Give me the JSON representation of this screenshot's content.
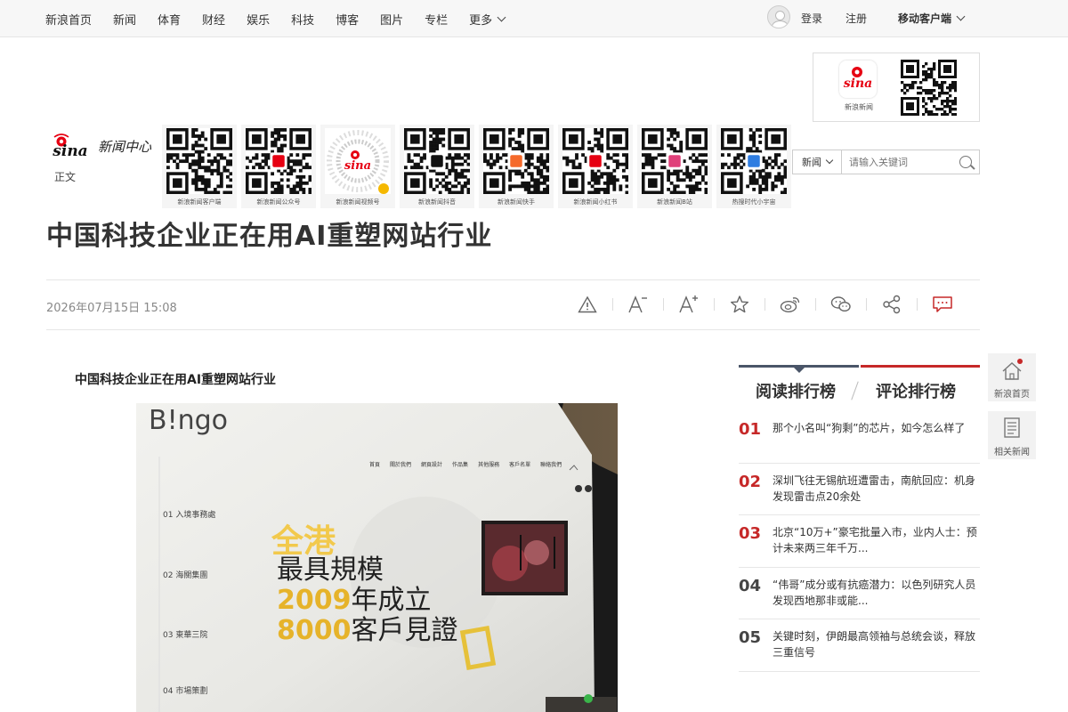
{
  "topnav": {
    "items": [
      "新浪首页",
      "新闻",
      "体育",
      "财经",
      "娱乐",
      "科技",
      "博客",
      "图片",
      "专栏"
    ],
    "more": "更多",
    "login": "登录",
    "register": "注册",
    "mobile": "移动客户端"
  },
  "header": {
    "app_label": "新浪新闻",
    "logo_text": "新闻中心",
    "section": "正文",
    "qr_codes": [
      "新浪新闻客户端",
      "新浪新闻公众号",
      "新浪新闻视频号",
      "新浪新闻抖音",
      "新浪新闻快手",
      "新浪新闻小红书",
      "新浪新闻B站",
      "热搜时代小宇宙"
    ]
  },
  "search": {
    "scope": "新闻",
    "placeholder": "请输入关键词"
  },
  "article": {
    "title": "中国科技企业正在用AI重塑网站行业",
    "date": "2026年07月15日 15:08",
    "subtitle": "中国科技企业正在用AI重塑网站行业",
    "photo": {
      "brand": "B!ngo",
      "menu": [
        "首頁",
        "關於我們",
        "網頁設計",
        "作品集",
        "其他服務",
        "客戶名單",
        "聯絡我們"
      ],
      "steps": [
        "01 入境事務處",
        "02 海關集團",
        "03 東華三院",
        "04 市場策劃"
      ],
      "line1": "全港",
      "line2": "最具規模",
      "line3_num": "2009",
      "line3": "年成立",
      "line4_num": "8000",
      "line4": "客戶見證"
    }
  },
  "ranking": {
    "tab_read": "阅读排行榜",
    "tab_comment": "评论排行榜",
    "items": [
      {
        "num": "01",
        "text": "那个小名叫“狗剩”的芯片，如今怎么样了"
      },
      {
        "num": "02",
        "text": "深圳飞往无锡航班遭雷击，南航回应：机身发现雷击点20余处"
      },
      {
        "num": "03",
        "text": "北京“10万+”豪宅批量入市，业内人士：预计未来两三年千万..."
      },
      {
        "num": "04",
        "text": "“伟哥”成分或有抗癌潜力：以色列研究人员发现西地那非或能..."
      },
      {
        "num": "05",
        "text": "关键时刻，伊朗最高领袖与总统会谈，释放三重信号"
      }
    ]
  },
  "side": {
    "home": "新浪首页",
    "related": "相关新闻"
  }
}
